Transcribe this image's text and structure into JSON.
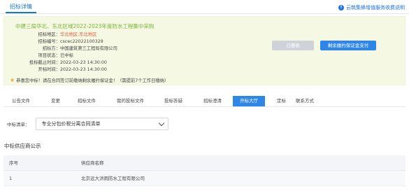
{
  "header": {
    "tab_label": "招标详情",
    "help_text": "云筑集蜂增值服务收费说明",
    "help_icon": "info-circle-icon"
  },
  "project": {
    "title": "中建三局华北、东北区域2022-2023年度防水工程集中采购",
    "fields": [
      {
        "label": "招标地区：",
        "value": "华北地区,东北地区",
        "highlight": true
      },
      {
        "label": "招标编号：",
        "value": "cscec22022100329",
        "highlight": false
      },
      {
        "label": "招标方：",
        "value": "中国建筑第三工程局有限公司",
        "highlight": false
      },
      {
        "label": "项目状态：",
        "value": "已中标",
        "highlight": false
      },
      {
        "label": "投标截止时间：",
        "value": "2022-03-23 14:30:00",
        "highlight": false
      },
      {
        "label": "开标时间：",
        "value": "2022-03-23 14:30:00",
        "highlight": false
      }
    ],
    "notice": "恭喜您中标！请在合同签订前缴纳剩余履约保证金！（需提前7个工作日缴纳）",
    "notice_icon": "star-icon"
  },
  "actions": {
    "withdraw_label": "已撤收",
    "pay_label": "剩余履约保证金支付"
  },
  "tabs": [
    {
      "label": "公告文件"
    },
    {
      "label": "变更"
    },
    {
      "label": "招标文件"
    },
    {
      "label": "我的投标文件"
    },
    {
      "label": "投标答疑"
    },
    {
      "label": "招标澄清"
    },
    {
      "label": "开标大厅"
    },
    {
      "label": "定标"
    },
    {
      "label": "联系方式"
    }
  ],
  "active_tab": "开标大厅",
  "filter": {
    "label": "中标清单：",
    "selected": "专业分包价税分离合同清单"
  },
  "suppliers": {
    "section_title": "中标供应商公示",
    "columns": [
      "序号",
      "供应商名称"
    ],
    "rows": [
      [
        "1",
        "北京远大洪雨防水工程有限公司"
      ]
    ]
  },
  "colors": {
    "primary": "#2e86e8",
    "title_green": "#7bb32e",
    "panel_bg": "#f5f9e4",
    "highlight_red": "#e05a3a"
  }
}
